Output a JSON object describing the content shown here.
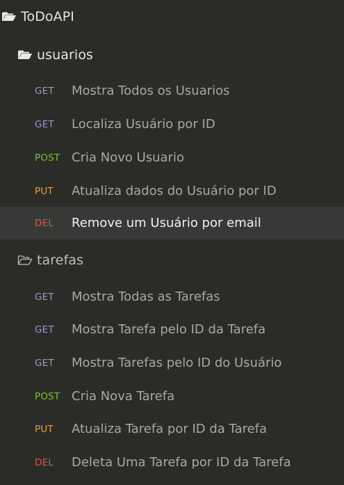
{
  "collection": {
    "name": "ToDoAPI",
    "icon": "folder-open-icon"
  },
  "folders": [
    {
      "name": "usuarios",
      "icon": "folder-open-icon",
      "requests": [
        {
          "method": "GET",
          "label": "Mostra Todos os Usuarios"
        },
        {
          "method": "GET",
          "label": "Localiza Usuário por ID"
        },
        {
          "method": "POST",
          "label": "Cria Novo Usuario"
        },
        {
          "method": "PUT",
          "label": "Atualiza dados do Usuário por ID"
        },
        {
          "method": "DEL",
          "label": "Remove um Usuário por email",
          "selected": true
        }
      ]
    },
    {
      "name": "tarefas",
      "icon": "folder-outline-icon",
      "requests": [
        {
          "method": "GET",
          "label": "Mostra Todas as Tarefas"
        },
        {
          "method": "GET",
          "label": "Mostra Tarefa pelo ID da Tarefa"
        },
        {
          "method": "GET",
          "label": "Mostra Tarefas pelo ID do Usuário"
        },
        {
          "method": "POST",
          "label": "Cria Nova Tarefa"
        },
        {
          "method": "PUT",
          "label": "Atualiza Tarefa por ID da Tarefa"
        },
        {
          "method": "DEL",
          "label": "Deleta Uma Tarefa por ID da Tarefa"
        }
      ]
    }
  ],
  "colors": {
    "background": "#2b2b28",
    "selected_row": "#383836",
    "GET": "#9b97d6",
    "POST": "#7dc13a",
    "PUT": "#e6a33a",
    "DEL": "#e0554a"
  }
}
